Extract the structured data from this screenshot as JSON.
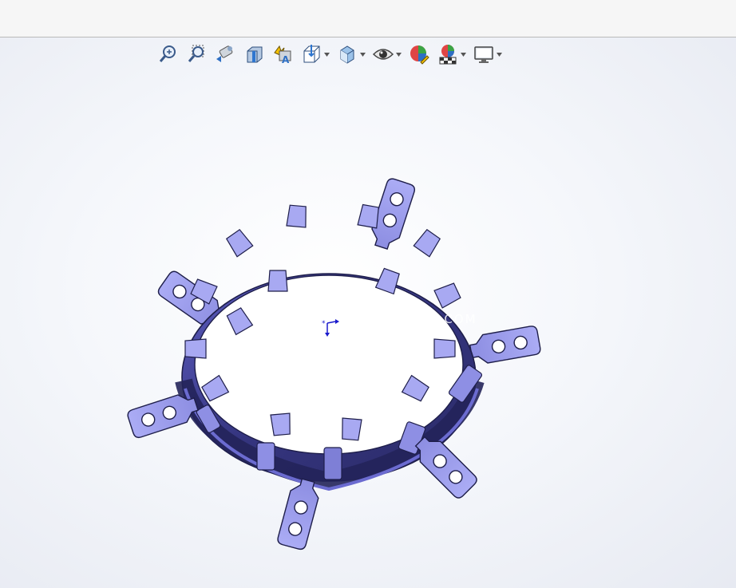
{
  "app": {
    "title": "",
    "accent": "#4a4ad0"
  },
  "toolbar": {
    "items": [
      {
        "name": "zoom-to-fit",
        "icon": "zoom-fit-icon"
      },
      {
        "name": "zoom-to-area",
        "icon": "zoom-area-icon"
      },
      {
        "name": "previous-view",
        "icon": "previous-view-icon"
      },
      {
        "name": "section-view",
        "icon": "section-view-icon"
      },
      {
        "name": "dynamic-annotation-views",
        "icon": "annotation-view-icon"
      },
      {
        "name": "view-orientation",
        "icon": "view-orientation-icon",
        "dropdown": true
      },
      {
        "name": "display-style",
        "icon": "display-style-icon",
        "dropdown": true
      },
      {
        "name": "hide-show-items",
        "icon": "eye-icon",
        "dropdown": true
      },
      {
        "name": "edit-appearance",
        "icon": "appearance-icon"
      },
      {
        "name": "apply-scene",
        "icon": "scene-icon",
        "dropdown": true
      },
      {
        "name": "view-settings",
        "icon": "monitor-icon",
        "dropdown": true
      }
    ]
  },
  "model": {
    "part_color": "#9fa0ef",
    "edge_color": "#1e1e4a"
  },
  "watermark": {
    "url_text": "WWW.YSH3D.COM"
  }
}
